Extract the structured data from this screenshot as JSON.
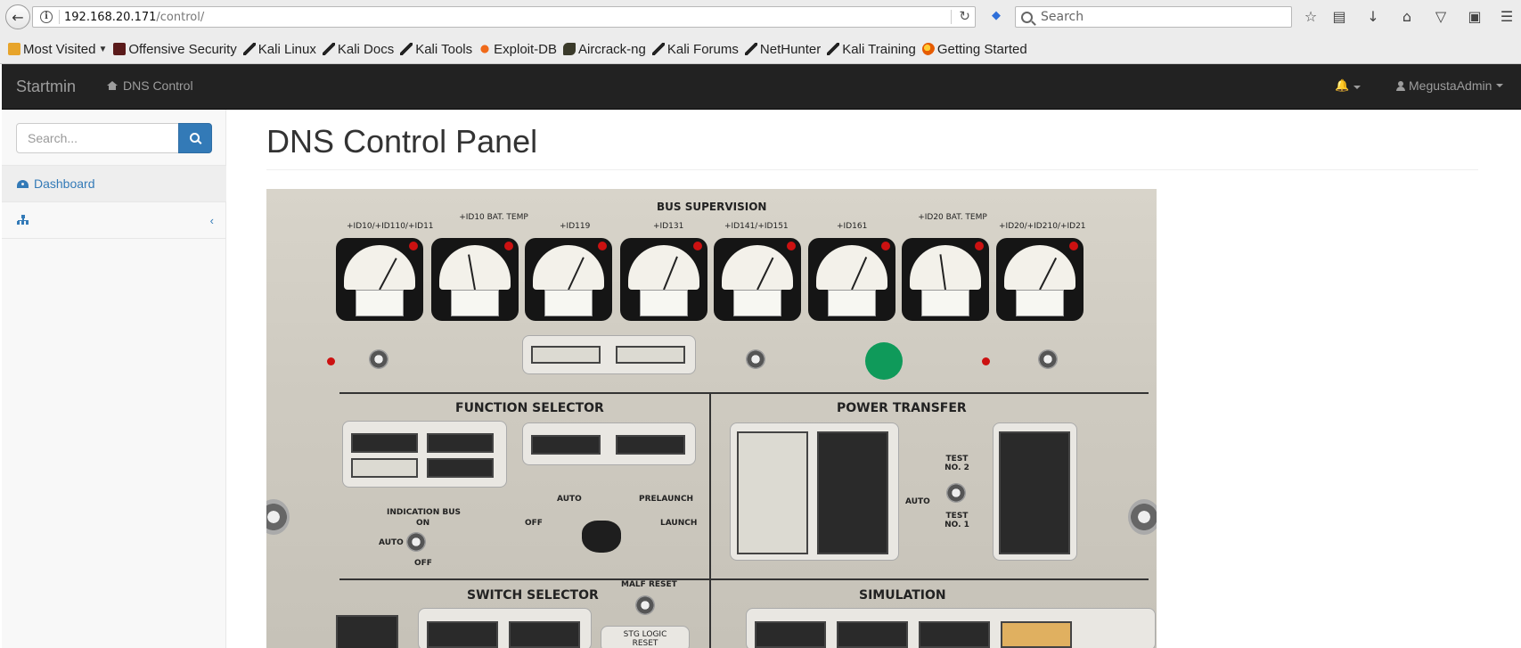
{
  "browser": {
    "url_host": "192.168.20.171",
    "url_path": "/control/",
    "search_placeholder": "Search",
    "back_glyph": "←",
    "reload_glyph": "↻",
    "icons": [
      "back-icon",
      "info-icon",
      "reload-icon",
      "addon-icon",
      "search-icon",
      "bookmark-star-icon",
      "reading-list-icon",
      "download-icon",
      "home-icon",
      "pocket-icon",
      "extension-icon",
      "menu-icon"
    ],
    "bookmarks": [
      {
        "label": "Most Visited",
        "icon": "folder"
      },
      {
        "label": "Offensive Security",
        "icon": "offsec"
      },
      {
        "label": "Kali Linux",
        "icon": "dragon"
      },
      {
        "label": "Kali Docs",
        "icon": "dragon"
      },
      {
        "label": "Kali Tools",
        "icon": "dragon"
      },
      {
        "label": "Exploit-DB",
        "icon": "edb"
      },
      {
        "label": "Aircrack-ng",
        "icon": "aircrack"
      },
      {
        "label": "Kali Forums",
        "icon": "dragon"
      },
      {
        "label": "NetHunter",
        "icon": "dragon"
      },
      {
        "label": "Kali Training",
        "icon": "dragon"
      },
      {
        "label": "Getting Started",
        "icon": "ff"
      }
    ]
  },
  "navbar": {
    "brand": "Startmin",
    "link": "DNS Control",
    "user": "MegustaAdmin"
  },
  "sidebar": {
    "search_placeholder": "Search...",
    "items": [
      {
        "label": "Dashboard",
        "icon": "dashboard-icon"
      },
      {
        "label": "",
        "icon": "sitemap-icon",
        "chevron": "‹"
      }
    ]
  },
  "main": {
    "title": "DNS Control Panel"
  },
  "photo": {
    "labels": {
      "bus_supervision": "BUS SUPERVISION",
      "function_selector": "FUNCTION SELECTOR",
      "power_transfer": "POWER TRANSFER",
      "switch_selector": "SWITCH SELECTOR",
      "simulation": "SIMULATION",
      "malf_reset": "MALF RESET",
      "stg_logic_reset": "STG LOGIC RESET",
      "indication_bus": "INDICATION BUS",
      "auto": "AUTO",
      "off": "OFF",
      "on": "ON",
      "prelaunch": "PRELAUNCH",
      "launch": "LAUNCH",
      "test_no2": "TEST NO. 2",
      "test_no1": "TEST NO. 1"
    },
    "meters": [
      "+ID10/+ID110/+ID11",
      "+ID10 BAT. TEMP",
      "+ID119",
      "+ID131",
      "+ID141/+ID151",
      "+ID161",
      "+ID20 BAT. TEMP",
      "+ID20/+ID210/+ID21"
    ],
    "colors": {
      "green_light": "#0f9a5a",
      "red_indicator": "#cc1111"
    }
  }
}
